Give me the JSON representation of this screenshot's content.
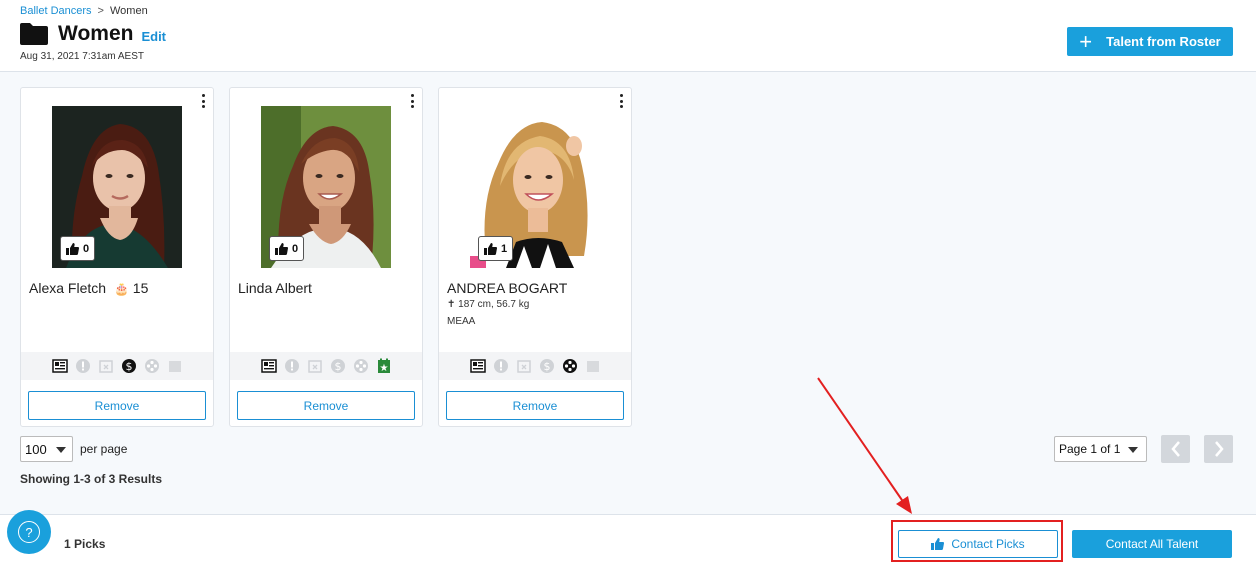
{
  "breadcrumb": {
    "parent": "Ballet Dancers",
    "separator": ">",
    "current": "Women"
  },
  "header": {
    "title": "Women",
    "edit_label": "Edit",
    "timestamp": "Aug 31, 2021 7:31am AEST",
    "roster_button": "Talent from Roster"
  },
  "cards": [
    {
      "name": "Alexa Fletch",
      "age": "15",
      "likes": "0",
      "stats": "",
      "union": "",
      "remove_label": "Remove"
    },
    {
      "name": "Linda Albert",
      "likes": "0",
      "stats": "",
      "union": "",
      "remove_label": "Remove"
    },
    {
      "name": "ANDREA BOGART",
      "likes": "1",
      "stats": "187 cm, 56.7 kg",
      "union": "MEAA",
      "remove_label": "Remove"
    }
  ],
  "pagination": {
    "per_page_value": "100",
    "per_page_label": "per page",
    "results_text": "Showing 1-3 of 3 Results",
    "page_label": "Page 1 of 1"
  },
  "footer": {
    "picks_text": "1 Picks",
    "contact_picks": "Contact Picks",
    "contact_all": "Contact All Talent",
    "help_symbol": "?"
  },
  "colors": {
    "accent": "#1aa0dc",
    "link": "#1a8fd4",
    "highlight": "#e32020",
    "approved_green": "#2a8a3a"
  }
}
